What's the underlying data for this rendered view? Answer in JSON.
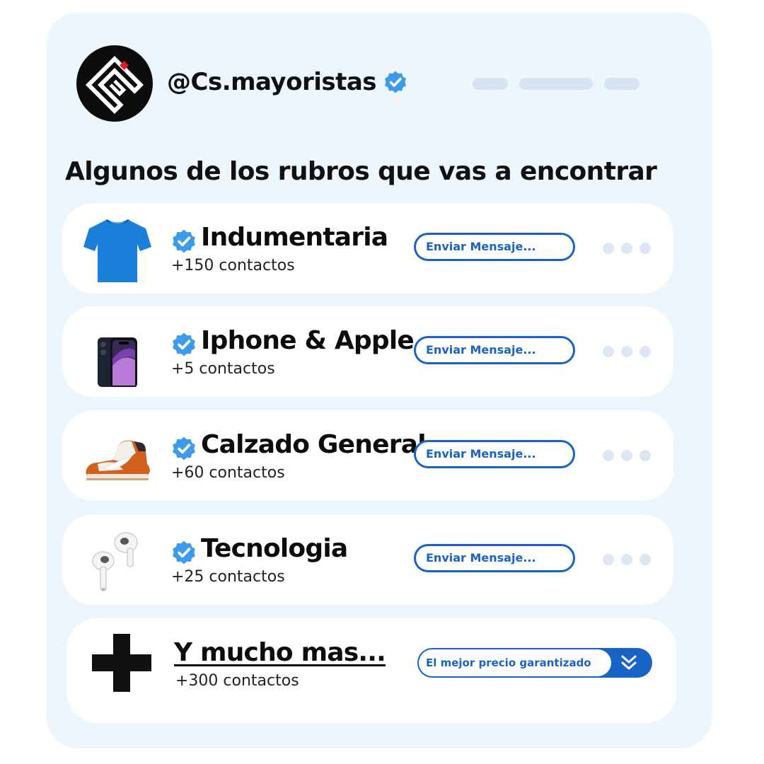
{
  "profile": {
    "handle": "@Cs.mayoristas",
    "verified_icon": "verified-badge-icon",
    "logo_icon": "cs-logo-icon"
  },
  "heading": "Algunos de los rubros que vas a encontrar",
  "categories": [
    {
      "title": "Indumentaria",
      "count": "+150 contactos",
      "button": "Enviar Mensaje...",
      "icon": "tshirt-icon"
    },
    {
      "title": "Iphone & Apple",
      "count": "+5 contactos",
      "button": "Enviar Mensaje...",
      "icon": "iphone-icon"
    },
    {
      "title": "Calzado General",
      "count": "+60 contactos",
      "button": "Enviar Mensaje...",
      "icon": "sneaker-icon"
    },
    {
      "title": "Tecnologia",
      "count": "+25 contactos",
      "button": "Enviar Mensaje...",
      "icon": "earbuds-icon"
    }
  ],
  "more": {
    "title": "Y mucho mas...",
    "count": "+300 contactos",
    "button": "El mejor precio garantizado",
    "icon": "plus-icon",
    "chevron_icon": "double-chevron-down-icon"
  },
  "colors": {
    "accent": "#1863c5",
    "card_bg": "#edf6fd",
    "verified": "#3d9be9",
    "placeholder": "#d6e3f3"
  }
}
